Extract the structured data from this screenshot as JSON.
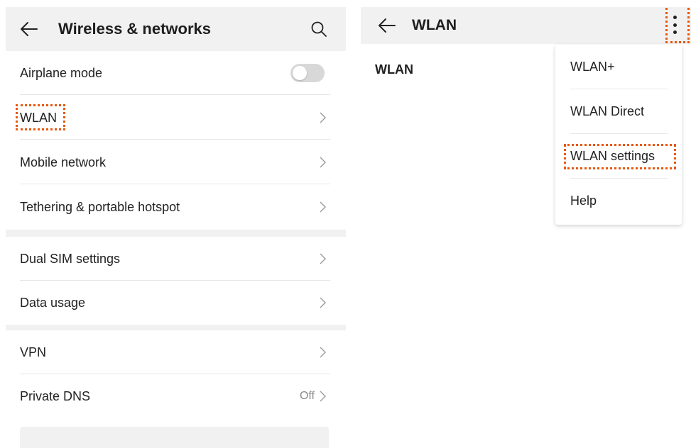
{
  "left": {
    "title": "Wireless & networks",
    "group1": [
      {
        "label": "Airplane mode",
        "type": "toggle",
        "on": false
      },
      {
        "label": "WLAN",
        "type": "nav"
      },
      {
        "label": "Mobile network",
        "type": "nav"
      },
      {
        "label": "Tethering & portable hotspot",
        "type": "nav"
      }
    ],
    "group2": [
      {
        "label": "Dual SIM settings",
        "type": "nav"
      },
      {
        "label": "Data usage",
        "type": "nav"
      }
    ],
    "group3": [
      {
        "label": "VPN",
        "type": "nav"
      },
      {
        "label": "Private DNS",
        "type": "nav",
        "value": "Off"
      }
    ]
  },
  "right": {
    "title": "WLAN",
    "wlan_label": "WLAN",
    "menu": [
      "WLAN+",
      "WLAN Direct",
      "WLAN settings",
      "Help"
    ]
  },
  "colors": {
    "highlight": "#e8570a",
    "background": "#f1f1f1",
    "card": "#ffffff",
    "text": "#222222",
    "secondary_text": "#8a8a8a"
  },
  "icons": [
    "back-arrow-icon",
    "search-icon",
    "chevron-right-icon",
    "more-vert-icon"
  ]
}
